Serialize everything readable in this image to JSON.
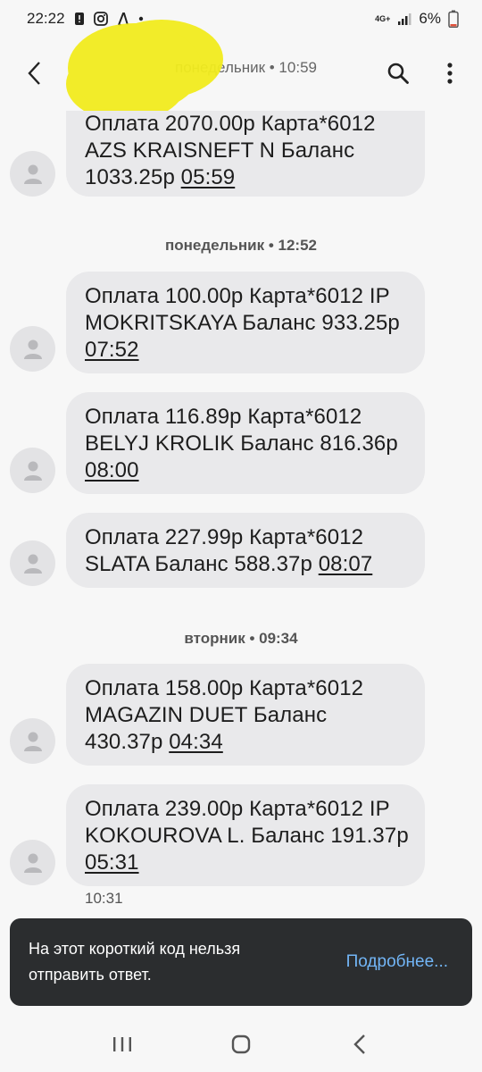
{
  "status_bar": {
    "time": "22:22",
    "network_type": "4G+",
    "battery": "6%",
    "left_icons": [
      "alert-icon",
      "instagram-icon",
      "app-icon",
      "dot-icon"
    ],
    "right_icons": [
      "network-type-icon",
      "signal-icon",
      "battery-icon"
    ]
  },
  "header": {
    "subtitle": "понедельник • 10:59",
    "actions": [
      "search-icon",
      "more-vert-icon"
    ]
  },
  "messages": [
    {
      "lines": [
        "Оплата 2070.00р Карта*6012",
        "AZS KRAISNEFT N Баланс"
      ],
      "last_prefix": "1033.25р ",
      "time": "05:59"
    },
    {
      "separator": "понедельник • 12:52"
    },
    {
      "lines": [
        "Оплата 100.00р Карта*6012 IP",
        "MOKRITSKAYA  Баланс 933.25р"
      ],
      "last_prefix": "",
      "time": "07:52"
    },
    {
      "lines": [
        "Оплата 116.89р Карта*6012",
        "BELYJ KROLIK Баланс 816.36р"
      ],
      "last_prefix": "",
      "time": "08:00"
    },
    {
      "lines": [
        "Оплата 227.99р Карта*6012"
      ],
      "last_prefix": "SLATA Баланс 588.37р ",
      "time": "08:07"
    },
    {
      "separator": "вторник • 09:34"
    },
    {
      "lines": [
        "Оплата 158.00р Карта*6012",
        "MAGAZIN DUET Баланс"
      ],
      "last_prefix": "430.37р ",
      "time": "04:34"
    },
    {
      "lines": [
        "Оплата 239.00р Карта*6012 IP",
        "KOKOUROVA L. Баланс 191.37р"
      ],
      "last_prefix": "",
      "time": "05:31"
    }
  ],
  "sent_time": "10:31",
  "snackbar": {
    "text": "На этот короткий код нельзя отправить ответ.",
    "action": "Подробнее..."
  },
  "nav": [
    "recent-apps-icon",
    "home-icon",
    "back-nav-icon"
  ]
}
